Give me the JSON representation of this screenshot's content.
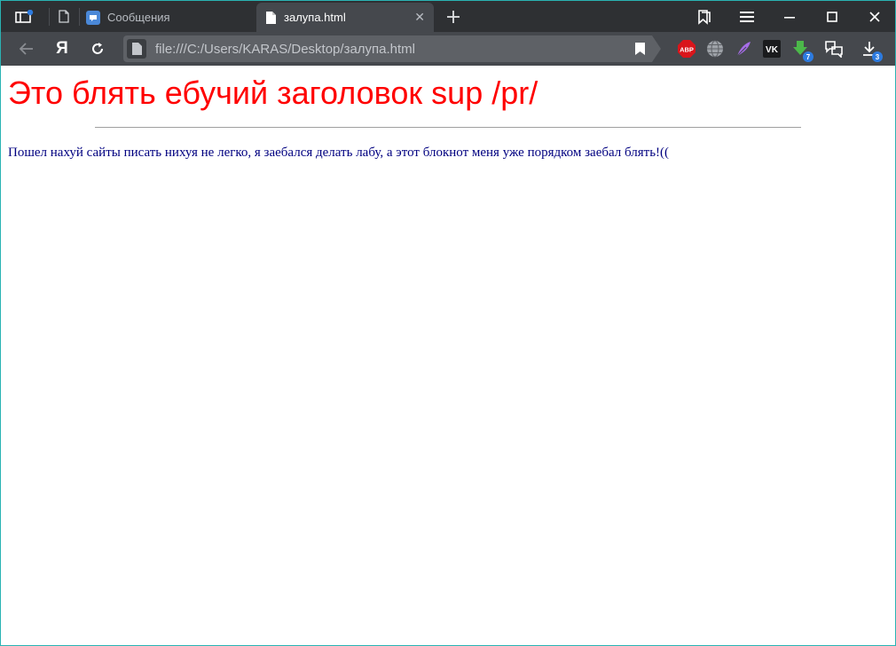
{
  "browser": {
    "tabs": [
      {
        "label": "Сообщения",
        "active": false
      },
      {
        "label": "залупа.html",
        "active": true
      }
    ],
    "new_tab_icon": "plus-icon",
    "address": "file:///C:/Users/KARAS/Desktop/залупа.html",
    "extensions": [
      {
        "name": "adblock-icon",
        "text": "ABP"
      },
      {
        "name": "globe-icon"
      },
      {
        "name": "feather-icon"
      },
      {
        "name": "vk-icon",
        "text": "VK"
      },
      {
        "name": "download-arrow-icon",
        "badge": "7"
      },
      {
        "name": "chat-icon"
      },
      {
        "name": "downloads-icon",
        "badge": "3"
      }
    ],
    "yandex_logo": "Я"
  },
  "page": {
    "heading": "Это блять ебучий заголовок sup /pr/",
    "paragraph": "Пошел нахуй сайты писать нихуя не легко, я заебался делать лабу, а этот блокнот меня уже порядком заебал блять!(("
  },
  "colors": {
    "heading": "#ff0000",
    "paragraph": "#000080",
    "tabbar": "#2e3033",
    "toolbar": "#45484d"
  }
}
